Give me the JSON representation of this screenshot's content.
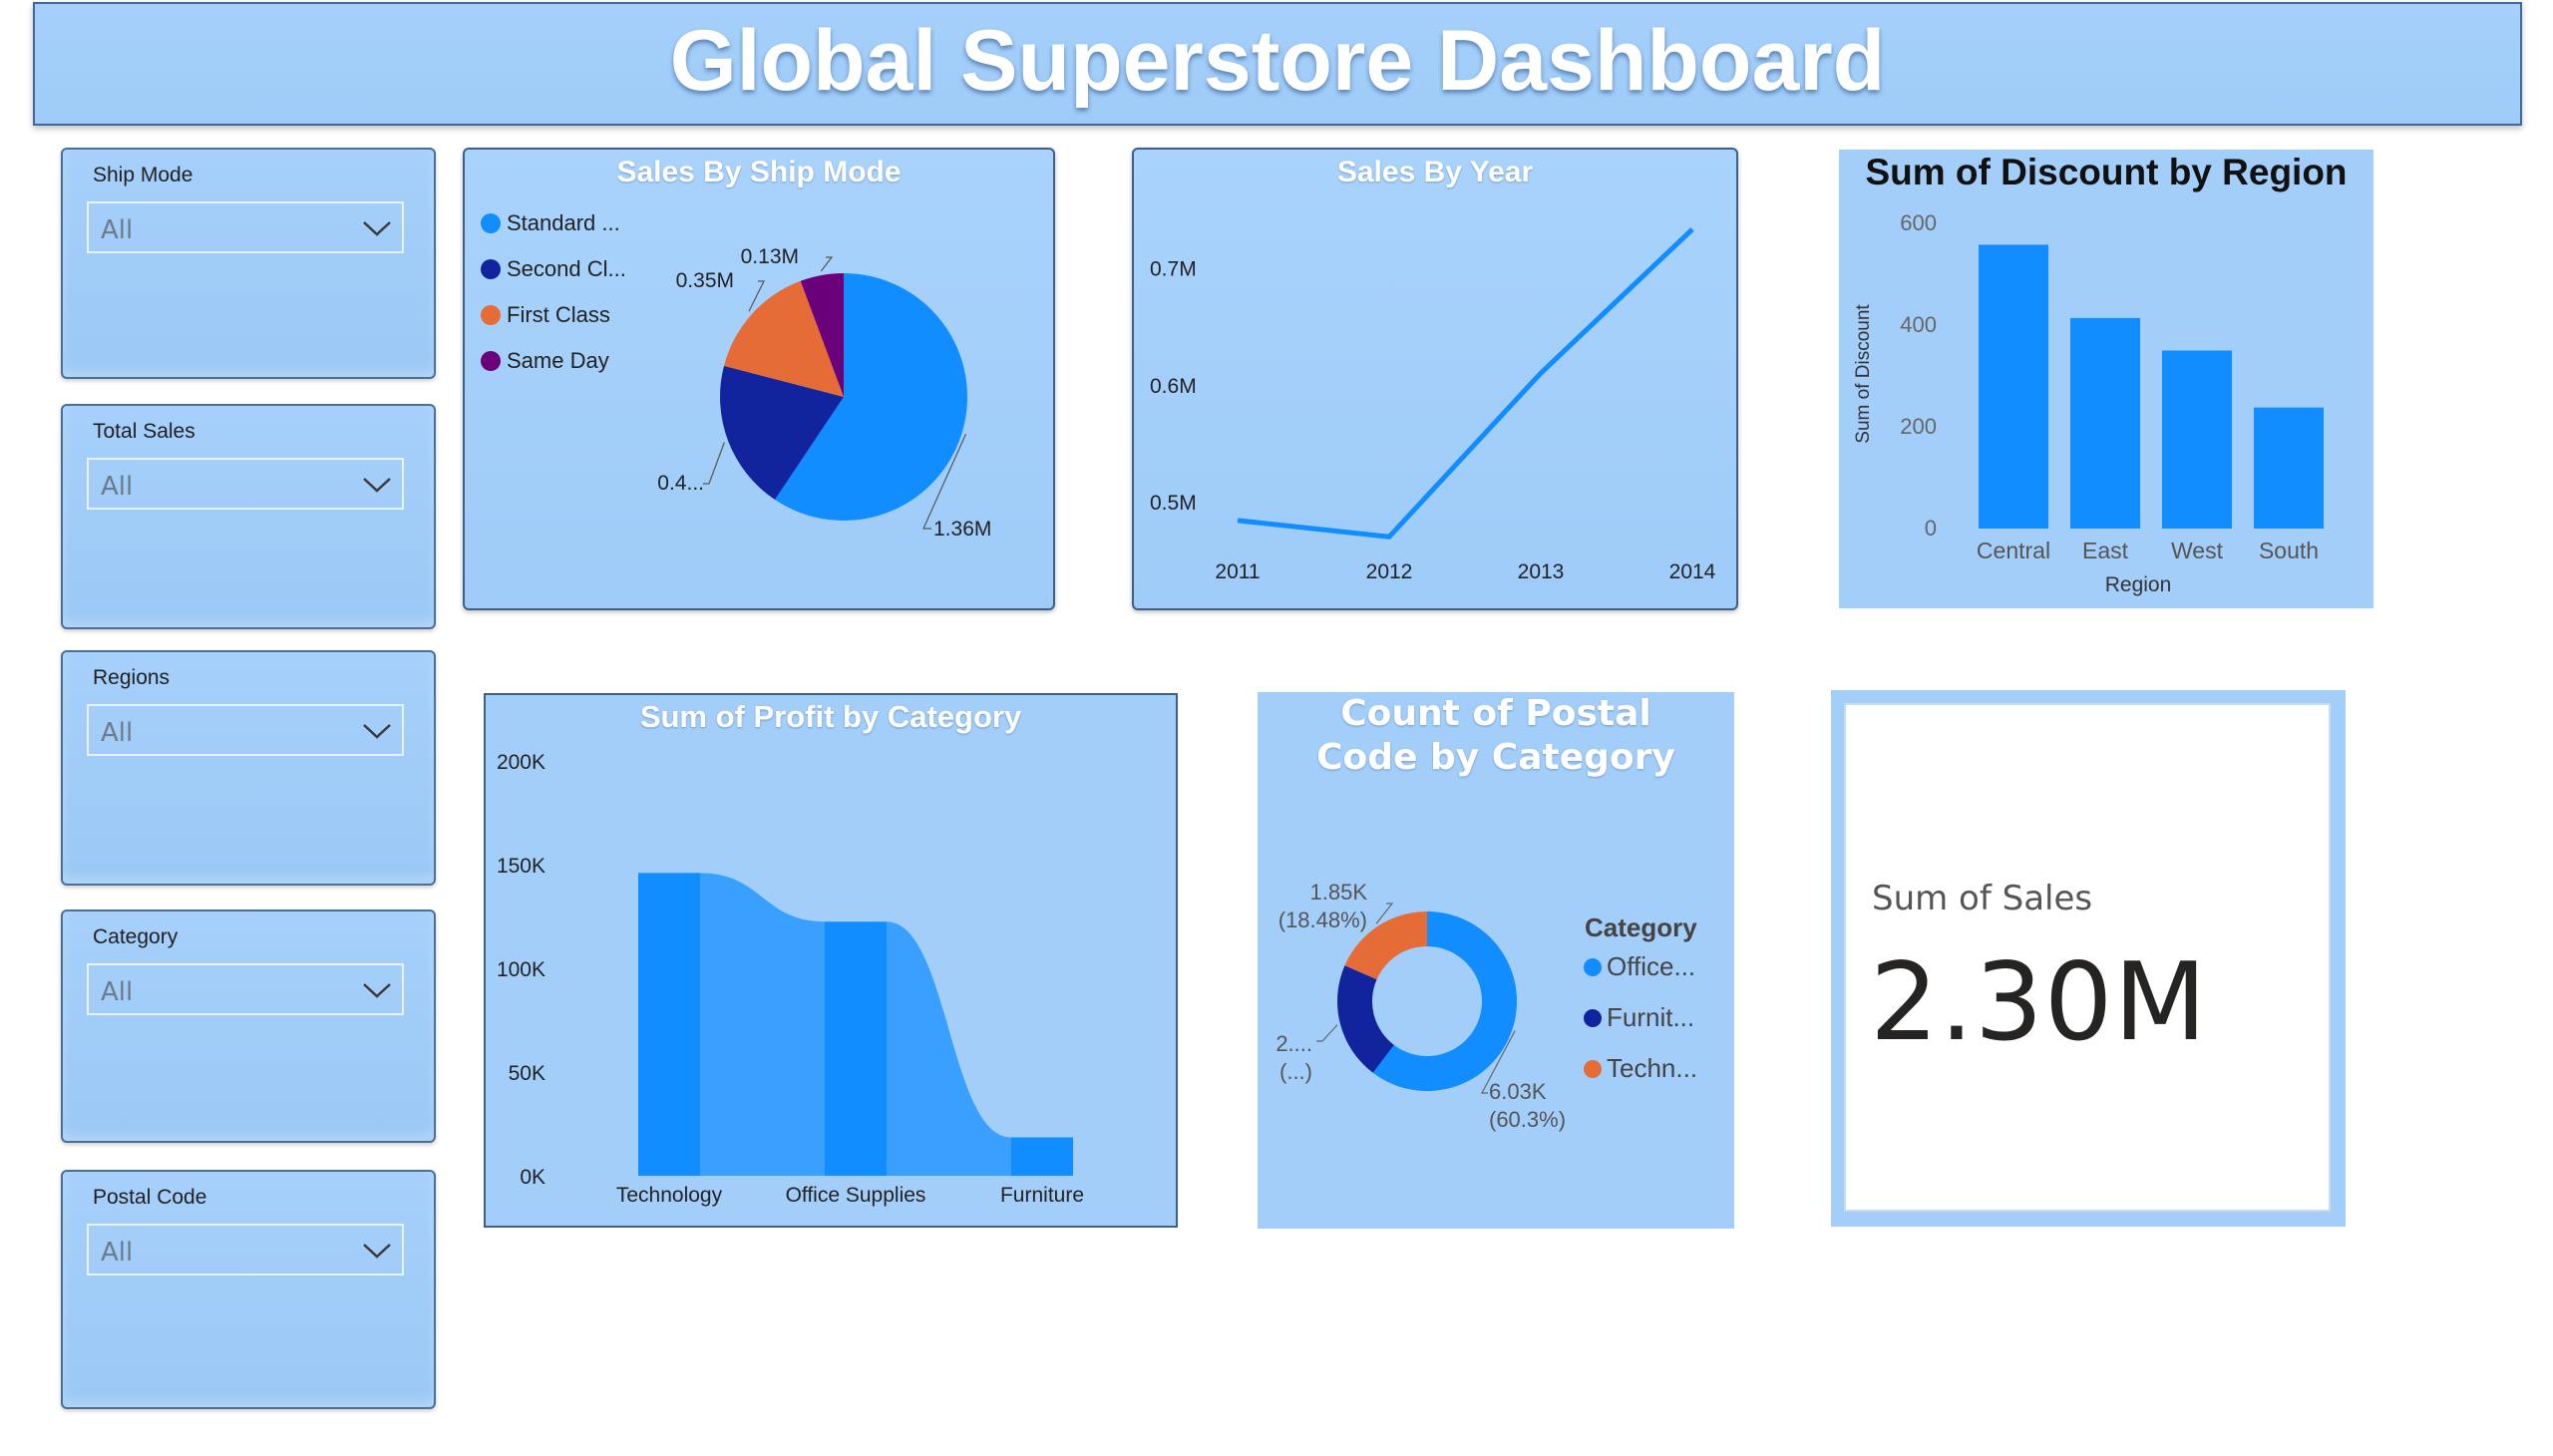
{
  "header": {
    "title": "Global Superstore Dashboard"
  },
  "slicers": [
    {
      "label": "Ship Mode",
      "value": "All"
    },
    {
      "label": "Total Sales",
      "value": "All"
    },
    {
      "label": "Regions",
      "value": "All"
    },
    {
      "label": "Category",
      "value": "All"
    },
    {
      "label": "Postal Code",
      "value": "All"
    }
  ],
  "kpi": {
    "label": "Sum of Sales",
    "value": "2.30M"
  },
  "colors": {
    "accent": "#118dff",
    "navy": "#12239e",
    "orange": "#e66c37",
    "purple": "#6b007b",
    "panel": "#a3cefa"
  },
  "chart_data": [
    {
      "type": "pie",
      "title": "Sales By Ship Mode",
      "legend": [
        "Standard ...",
        "Second Cl...",
        "First Class",
        "Same Day"
      ],
      "values": [
        1.36,
        0.45,
        0.35,
        0.13
      ],
      "data_labels": [
        "1.36M",
        "0.4...",
        "0.35M",
        "0.13M"
      ],
      "colors": [
        "#118dff",
        "#12239e",
        "#e66c37",
        "#6b007b"
      ],
      "legend_position": "left"
    },
    {
      "type": "line",
      "title": "Sales By Year",
      "x": [
        "2011",
        "2012",
        "2013",
        "2014"
      ],
      "values": [
        0.484,
        0.47,
        0.61,
        0.733
      ],
      "y_ticks": [
        "0.5M",
        "0.6M",
        "0.7M"
      ],
      "ylim": [
        0.46,
        0.75
      ],
      "color": "#118dff",
      "grid": false
    },
    {
      "type": "bar",
      "title": "Sum of Discount by Region",
      "categories": [
        "Central",
        "East",
        "West",
        "South"
      ],
      "values": [
        558,
        414,
        350,
        238
      ],
      "xlabel": "Region",
      "ylabel": "Sum of Discount",
      "y_ticks": [
        "0",
        "200",
        "400",
        "600"
      ],
      "ylim": [
        0,
        600
      ],
      "color": "#118dff"
    },
    {
      "type": "bar",
      "title": "Sum of Profit by Category",
      "categories": [
        "Technology",
        "Office Supplies",
        "Furniture"
      ],
      "values": [
        146000,
        122500,
        18500
      ],
      "y_ticks": [
        "0K",
        "50K",
        "100K",
        "150K",
        "200K"
      ],
      "ylim": [
        0,
        200000
      ],
      "color": "#118dff",
      "ribbon_color": "#3aa0ff"
    },
    {
      "type": "pie",
      "title": "Count of Postal Code by Category",
      "legend_title": "Category",
      "legend": [
        "Office...",
        "Furnit...",
        "Techn..."
      ],
      "values": [
        60.3,
        21.22,
        18.48
      ],
      "data_labels": [
        [
          "6.03K",
          "(60.3%)"
        ],
        [
          "2....",
          "(...)"
        ],
        [
          "1.85K",
          "(18.48%)"
        ]
      ],
      "colors": [
        "#118dff",
        "#12239e",
        "#e66c37"
      ],
      "donut": true,
      "legend_position": "right"
    }
  ]
}
